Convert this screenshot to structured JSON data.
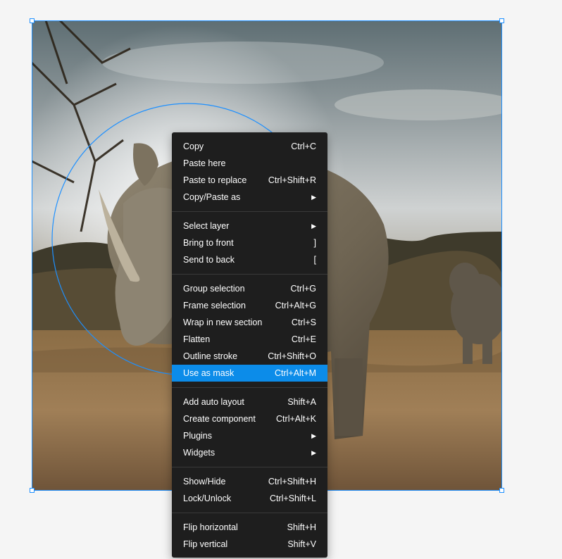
{
  "canvas": {
    "selection_color": "#1e90ff",
    "image_subject": "rhinoceros photograph"
  },
  "menu": {
    "groups": [
      [
        {
          "label": "Copy",
          "shortcut": "Ctrl+C"
        },
        {
          "label": "Paste here",
          "shortcut": ""
        },
        {
          "label": "Paste to replace",
          "shortcut": "Ctrl+Shift+R"
        },
        {
          "label": "Copy/Paste as",
          "shortcut": "",
          "submenu": true
        }
      ],
      [
        {
          "label": "Select layer",
          "shortcut": "",
          "submenu": true
        },
        {
          "label": "Bring to front",
          "shortcut": "]"
        },
        {
          "label": "Send to back",
          "shortcut": "["
        }
      ],
      [
        {
          "label": "Group selection",
          "shortcut": "Ctrl+G"
        },
        {
          "label": "Frame selection",
          "shortcut": "Ctrl+Alt+G"
        },
        {
          "label": "Wrap in new section",
          "shortcut": "Ctrl+S"
        },
        {
          "label": "Flatten",
          "shortcut": "Ctrl+E"
        },
        {
          "label": "Outline stroke",
          "shortcut": "Ctrl+Shift+O"
        },
        {
          "label": "Use as mask",
          "shortcut": "Ctrl+Alt+M",
          "active": true
        }
      ],
      [
        {
          "label": "Add auto layout",
          "shortcut": "Shift+A"
        },
        {
          "label": "Create component",
          "shortcut": "Ctrl+Alt+K"
        },
        {
          "label": "Plugins",
          "shortcut": "",
          "submenu": true
        },
        {
          "label": "Widgets",
          "shortcut": "",
          "submenu": true
        }
      ],
      [
        {
          "label": "Show/Hide",
          "shortcut": "Ctrl+Shift+H"
        },
        {
          "label": "Lock/Unlock",
          "shortcut": "Ctrl+Shift+L"
        }
      ],
      [
        {
          "label": "Flip horizontal",
          "shortcut": "Shift+H"
        },
        {
          "label": "Flip vertical",
          "shortcut": "Shift+V"
        }
      ]
    ],
    "submenu_icon": "chevron-right-icon",
    "background": "#1e1e1e",
    "active_color": "#0c8ce9"
  }
}
